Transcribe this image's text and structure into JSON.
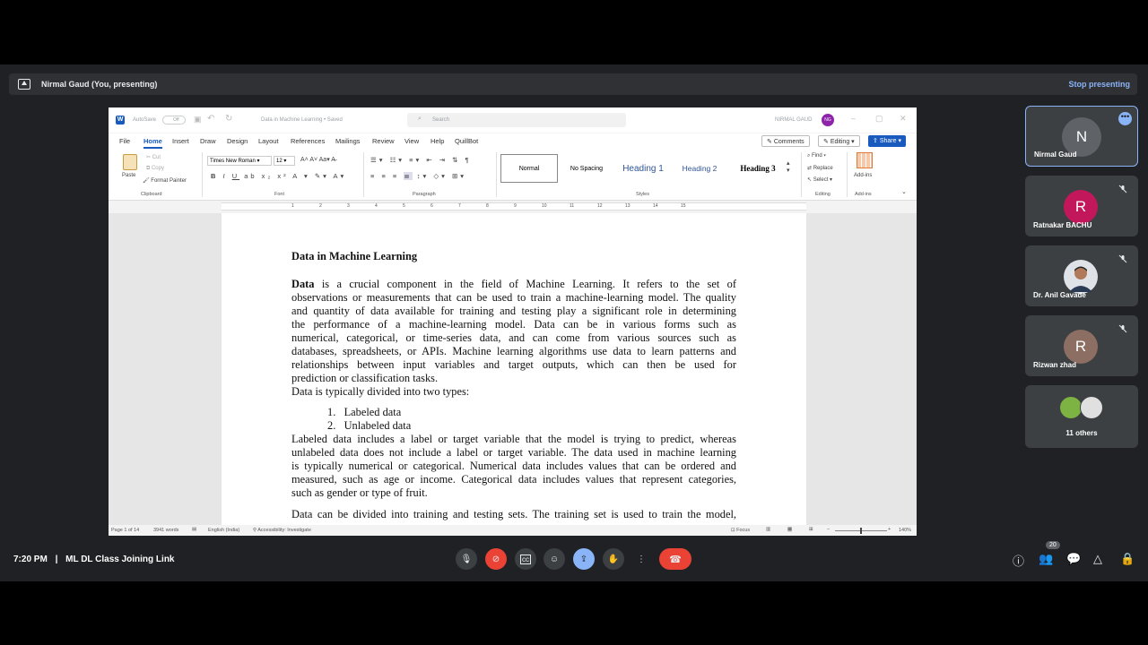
{
  "meet": {
    "presenting_text": "Nirmal Gaud (You, presenting)",
    "stop_presenting": "Stop presenting",
    "clock": "7:20 PM",
    "separator": "|",
    "meeting_title": "ML DL Class Joining Link",
    "people_count": "20",
    "colors": {
      "background": "#202124",
      "accent": "#8ab4f8",
      "hangup": "#ea4335",
      "active_control": "#8ab4f8"
    }
  },
  "participants": [
    {
      "name": "Nirmal Gaud",
      "initial": "N",
      "avatar_color": "#5f6368",
      "muted": false
    },
    {
      "name": "Ratnakar BACHU",
      "initial": "R",
      "avatar_color": "#c2185b",
      "muted": true
    },
    {
      "name": "Dr. Anil Gavade",
      "initial": "",
      "avatar_color": "#6d4c41",
      "muted": true
    },
    {
      "name": "Rizwan zhad",
      "initial": "R",
      "avatar_color": "#8d6e63",
      "muted": true
    }
  ],
  "others_label": "11 others",
  "word": {
    "autosave": "AutoSave",
    "autosave_state": "Off",
    "doc_title": "Data in Machine Learning • Saved",
    "search_placeholder": "Search",
    "user_name": "NIRMAL GAUD",
    "user_initials": "NG",
    "menu": [
      "File",
      "Home",
      "Insert",
      "Draw",
      "Design",
      "Layout",
      "References",
      "Mailings",
      "Review",
      "View",
      "Help",
      "QuillBot"
    ],
    "comments": "Comments",
    "editing": "Editing",
    "share": "Share",
    "clipboard": {
      "paste": "Paste",
      "cut": "Cut",
      "copy": "Copy",
      "format_painter": "Format Painter",
      "group": "Clipboard"
    },
    "font": {
      "name": "Times New Roman",
      "size": "12",
      "group": "Font"
    },
    "paragraph_group": "Paragraph",
    "styles": [
      "Normal",
      "No Spacing",
      "Heading 1",
      "Heading 2",
      "Heading 3"
    ],
    "styles_group": "Styles",
    "editing_group": {
      "find": "Find",
      "replace": "Replace",
      "select": "Select",
      "group": "Editing"
    },
    "addins": {
      "label": "Add-ins",
      "group": "Add-ins"
    },
    "ruler_numbers": [
      "1",
      "2",
      "3",
      "4",
      "5",
      "6",
      "7",
      "8",
      "9",
      "10",
      "11",
      "12",
      "13",
      "14",
      "15"
    ],
    "status": {
      "page": "Page 1 of 14",
      "words": "3941 words",
      "language": "English (India)",
      "accessibility": "Accessibility: Investigate",
      "focus": "Focus",
      "zoom": "140%"
    }
  },
  "document": {
    "heading": "Data in Machine Learning",
    "para1_bold": "Data",
    "para1_lines": [
      " is a crucial component in the field of Machine Learning. It refers to the set of",
      "observations or measurements that can be used to train a machine-learning model. The quality",
      "and quantity of data available for training and testing play a significant role in determining",
      "the performance of a machine-learning model. Data can be in various forms such as",
      "numerical, categorical, or time-series data, and can come from various sources such as",
      "databases, spreadsheets, or APIs. Machine learning algorithms use data to learn patterns and",
      "relationships between input variables and target outputs, which can then be used for",
      "prediction or classification tasks."
    ],
    "types_intro": "Data is typically divided into two types:",
    "types": [
      {
        "num": "1.",
        "text": "Labeled data"
      },
      {
        "num": "2.",
        "text": "Unlabeled data"
      }
    ],
    "para2_lines": [
      "Labeled data includes a label or target variable that the model is trying to predict, whereas",
      "unlabeled data does not include a label or target variable. The data used in machine learning",
      "is typically numerical or categorical. Numerical data includes values that can be ordered and",
      "measured, such as age or income. Categorical data includes values that represent categories,",
      "such as gender or type of fruit."
    ],
    "para3": "Data can be divided into training and testing sets. The training set is used to train the model,"
  }
}
